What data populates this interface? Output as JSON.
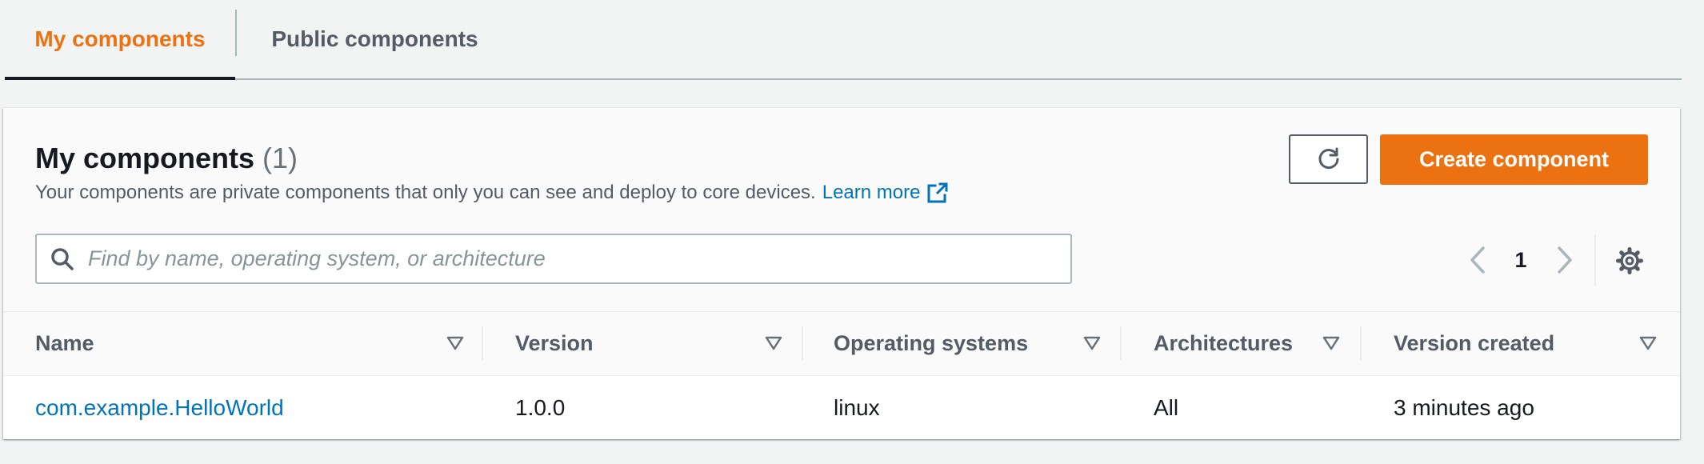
{
  "tabs": [
    {
      "label": "My components",
      "active": true
    },
    {
      "label": "Public components",
      "active": false
    }
  ],
  "header": {
    "title": "My components",
    "count": "(1)",
    "description": "Your components are private components that only you can see and deploy to core devices.",
    "learn_more": "Learn more",
    "create_button": "Create component"
  },
  "icons": {
    "refresh": "refresh-icon",
    "external_link": "external-link-icon",
    "search": "search-icon",
    "prev": "chevron-left-icon",
    "next": "chevron-right-icon",
    "settings": "gear-icon",
    "sort": "caret-down-icon"
  },
  "search": {
    "placeholder": "Find by name, operating system, or architecture",
    "value": ""
  },
  "pagination": {
    "current_page": "1"
  },
  "table": {
    "columns": [
      "Name",
      "Version",
      "Operating systems",
      "Architectures",
      "Version created"
    ],
    "rows": [
      {
        "name": "com.example.HelloWorld",
        "version": "1.0.0",
        "operating_systems": "linux",
        "architectures": "All",
        "version_created": "3 minutes ago"
      }
    ]
  },
  "colors": {
    "accent": "#ec7211",
    "link": "#0073bb",
    "text": "#16191f",
    "muted": "#545b64",
    "background": "#f2f3f3"
  }
}
